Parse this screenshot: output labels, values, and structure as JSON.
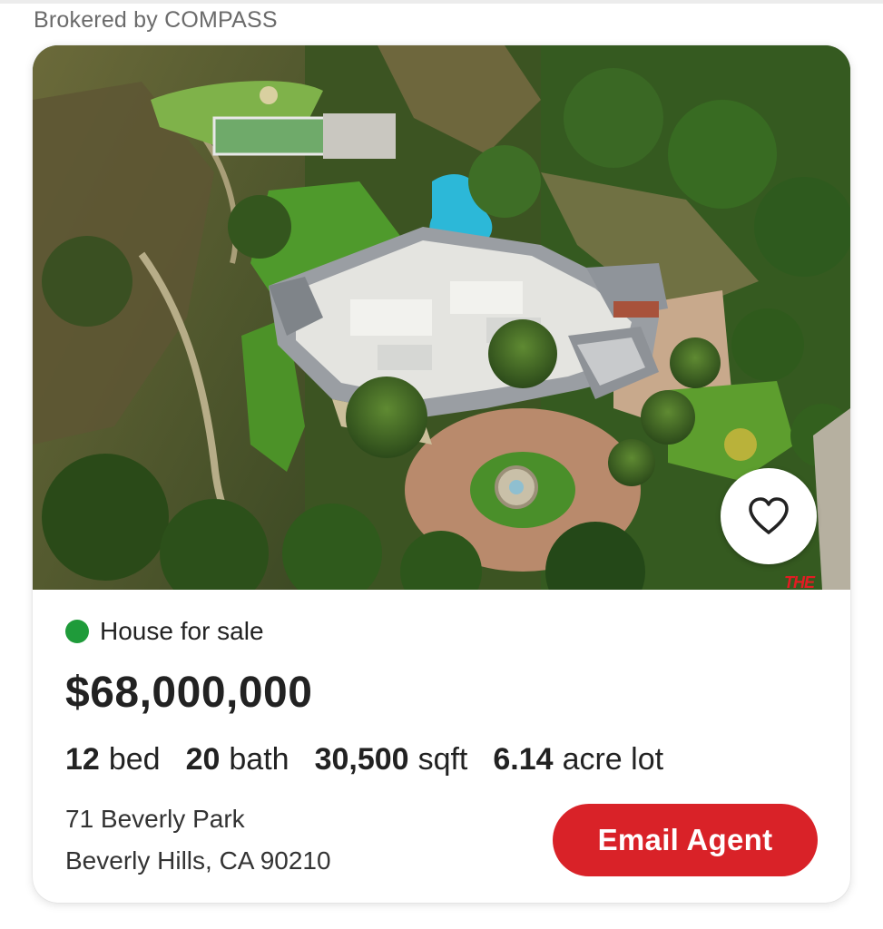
{
  "broker": "Brokered by COMPASS",
  "listing": {
    "status": "House for sale",
    "status_color": "#1f9b3a",
    "price": "$68,000,000",
    "specs": [
      {
        "value": "12",
        "unit": "bed"
      },
      {
        "value": "20",
        "unit": "bath"
      },
      {
        "value": "30,500",
        "unit": "sqft"
      },
      {
        "value": "6.14",
        "unit": "acre lot"
      }
    ],
    "address_line1": "71 Beverly Park",
    "address_line2": "Beverly Hills, CA 90210",
    "watermark": "THE"
  },
  "actions": {
    "email_label": "Email Agent",
    "email_color": "#d92228",
    "favorite_icon": "heart-icon"
  }
}
